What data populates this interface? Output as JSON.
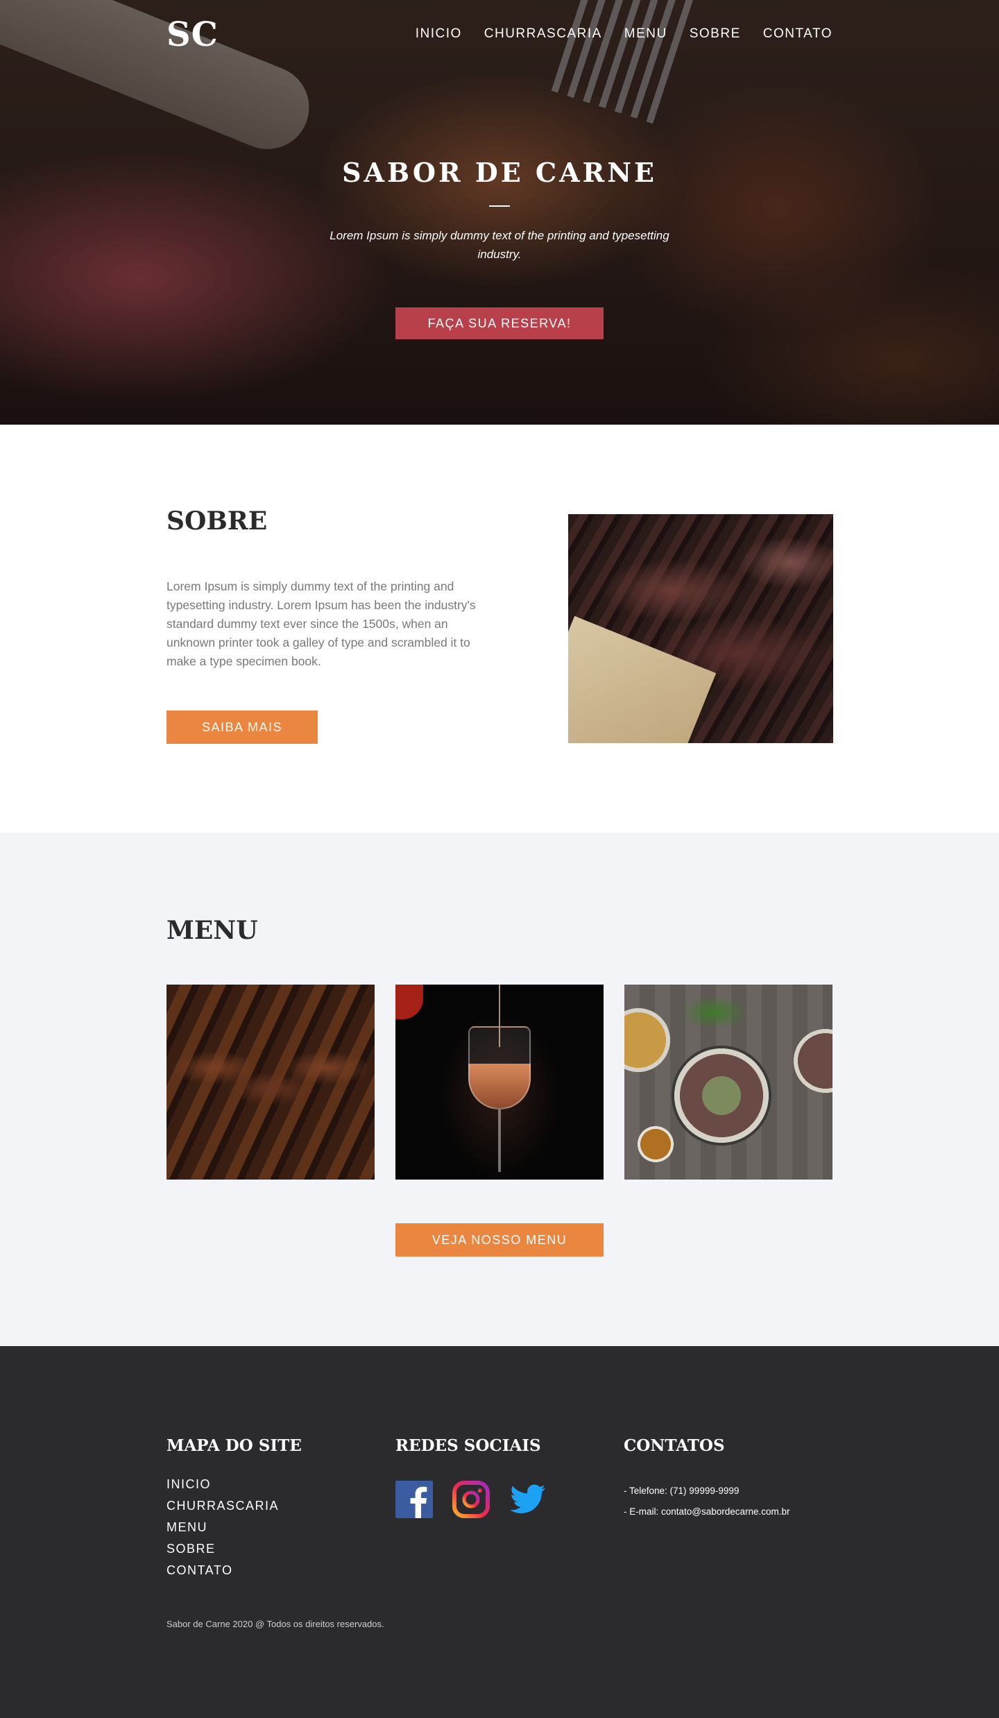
{
  "header": {
    "logo": "SC",
    "nav": [
      "INICIO",
      "CHURRASCARIA",
      "MENU",
      "SOBRE",
      "CONTATO"
    ]
  },
  "hero": {
    "title": "SABOR DE CARNE",
    "subtitle": "Lorem Ipsum is simply dummy text of the printing and typesetting industry.",
    "cta_label": "FAÇA SUA RESERVA!"
  },
  "sobre": {
    "title": "SOBRE",
    "text": "Lorem Ipsum is simply dummy text of the printing and typesetting industry. Lorem Ipsum has been the industry's standard dummy text ever since the 1500s, when an unknown printer took a galley of type and scrambled it to make a type specimen book.",
    "cta_label": "SAIBA MAIS"
  },
  "menu": {
    "title": "MENU",
    "cta_label": "VEJA NOSSO MENU"
  },
  "footer": {
    "mapa_title": "MAPA DO SITE",
    "mapa_links": [
      "INICIO",
      "CHURRASCARIA",
      "MENU",
      "SOBRE",
      "CONTATO"
    ],
    "redes_title": "REDES SOCIAIS",
    "social_icons": [
      "facebook-icon",
      "instagram-icon",
      "twitter-icon"
    ],
    "contatos_title": "CONTATOS",
    "telefone": "- Telefone: (71) 99999-9999",
    "email": "- E-mail: contato@sabordecarne.com.br",
    "copyright": "Sabor de Carne 2020 @ Todos os direitos reservados."
  },
  "colors": {
    "reserve_button": "#b8404a",
    "accent_orange": "#ea8640",
    "footer_bg": "#2b2a2c",
    "menu_bg": "#f3f4f8"
  }
}
